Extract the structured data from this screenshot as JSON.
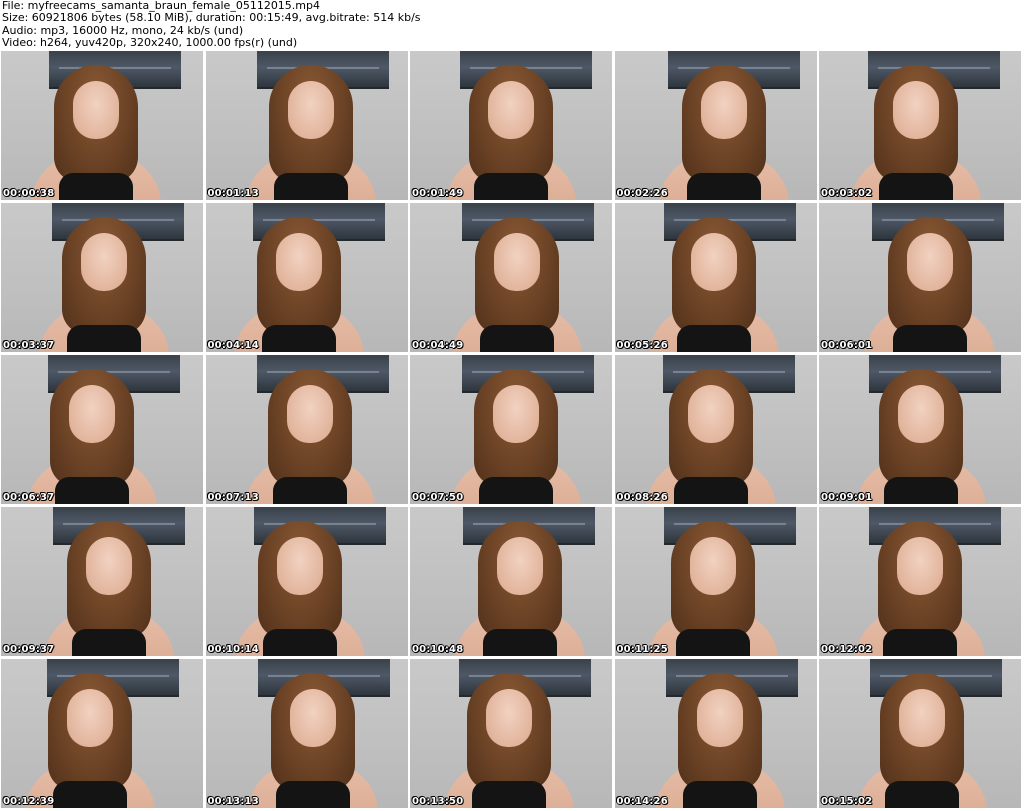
{
  "header": {
    "file_line": "File: myfreecams_samanta_braun_female_05112015.mp4",
    "size_line": "Size: 60921806 bytes (58.10 MiB), duration: 00:15:49, avg.bitrate: 514 kb/s",
    "audio_line": "Audio: mp3, 16000 Hz, mono, 24 kb/s (und)",
    "video_line": "Video: h264, yuv420p, 320x240, 1000.00 fps(r) (und)"
  },
  "thumbnails": [
    {
      "timestamp": "00:00:38"
    },
    {
      "timestamp": "00:01:13"
    },
    {
      "timestamp": "00:01:49"
    },
    {
      "timestamp": "00:02:26"
    },
    {
      "timestamp": "00:03:02"
    },
    {
      "timestamp": "00:03:37"
    },
    {
      "timestamp": "00:04:14"
    },
    {
      "timestamp": "00:04:49"
    },
    {
      "timestamp": "00:05:26"
    },
    {
      "timestamp": "00:06:01"
    },
    {
      "timestamp": "00:06:37"
    },
    {
      "timestamp": "00:07:13"
    },
    {
      "timestamp": "00:07:50"
    },
    {
      "timestamp": "00:08:26"
    },
    {
      "timestamp": "00:09:01"
    },
    {
      "timestamp": "00:09:37"
    },
    {
      "timestamp": "00:10:14"
    },
    {
      "timestamp": "00:10:48"
    },
    {
      "timestamp": "00:11:25"
    },
    {
      "timestamp": "00:12:02"
    },
    {
      "timestamp": "00:12:39"
    },
    {
      "timestamp": "00:13:13"
    },
    {
      "timestamp": "00:13:50"
    },
    {
      "timestamp": "00:14:26"
    },
    {
      "timestamp": "00:15:02"
    }
  ]
}
